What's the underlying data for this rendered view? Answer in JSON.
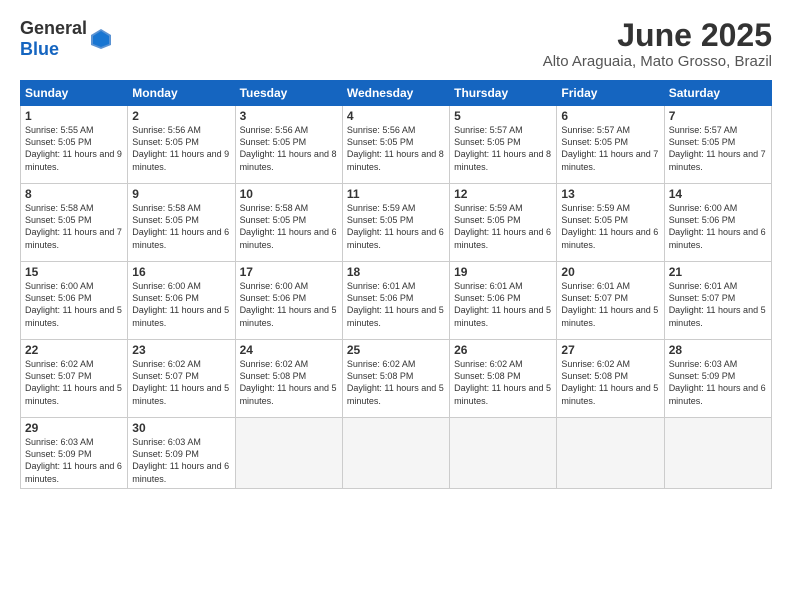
{
  "logo": {
    "general": "General",
    "blue": "Blue"
  },
  "title": "June 2025",
  "location": "Alto Araguaia, Mato Grosso, Brazil",
  "headers": [
    "Sunday",
    "Monday",
    "Tuesday",
    "Wednesday",
    "Thursday",
    "Friday",
    "Saturday"
  ],
  "weeks": [
    [
      {
        "day": "1",
        "sunrise": "5:55 AM",
        "sunset": "5:05 PM",
        "daylight": "11 hours and 9 minutes."
      },
      {
        "day": "2",
        "sunrise": "5:56 AM",
        "sunset": "5:05 PM",
        "daylight": "11 hours and 9 minutes."
      },
      {
        "day": "3",
        "sunrise": "5:56 AM",
        "sunset": "5:05 PM",
        "daylight": "11 hours and 8 minutes."
      },
      {
        "day": "4",
        "sunrise": "5:56 AM",
        "sunset": "5:05 PM",
        "daylight": "11 hours and 8 minutes."
      },
      {
        "day": "5",
        "sunrise": "5:57 AM",
        "sunset": "5:05 PM",
        "daylight": "11 hours and 8 minutes."
      },
      {
        "day": "6",
        "sunrise": "5:57 AM",
        "sunset": "5:05 PM",
        "daylight": "11 hours and 7 minutes."
      },
      {
        "day": "7",
        "sunrise": "5:57 AM",
        "sunset": "5:05 PM",
        "daylight": "11 hours and 7 minutes."
      }
    ],
    [
      {
        "day": "8",
        "sunrise": "5:58 AM",
        "sunset": "5:05 PM",
        "daylight": "11 hours and 7 minutes."
      },
      {
        "day": "9",
        "sunrise": "5:58 AM",
        "sunset": "5:05 PM",
        "daylight": "11 hours and 6 minutes."
      },
      {
        "day": "10",
        "sunrise": "5:58 AM",
        "sunset": "5:05 PM",
        "daylight": "11 hours and 6 minutes."
      },
      {
        "day": "11",
        "sunrise": "5:59 AM",
        "sunset": "5:05 PM",
        "daylight": "11 hours and 6 minutes."
      },
      {
        "day": "12",
        "sunrise": "5:59 AM",
        "sunset": "5:05 PM",
        "daylight": "11 hours and 6 minutes."
      },
      {
        "day": "13",
        "sunrise": "5:59 AM",
        "sunset": "5:05 PM",
        "daylight": "11 hours and 6 minutes."
      },
      {
        "day": "14",
        "sunrise": "6:00 AM",
        "sunset": "5:06 PM",
        "daylight": "11 hours and 6 minutes."
      }
    ],
    [
      {
        "day": "15",
        "sunrise": "6:00 AM",
        "sunset": "5:06 PM",
        "daylight": "11 hours and 5 minutes."
      },
      {
        "day": "16",
        "sunrise": "6:00 AM",
        "sunset": "5:06 PM",
        "daylight": "11 hours and 5 minutes."
      },
      {
        "day": "17",
        "sunrise": "6:00 AM",
        "sunset": "5:06 PM",
        "daylight": "11 hours and 5 minutes."
      },
      {
        "day": "18",
        "sunrise": "6:01 AM",
        "sunset": "5:06 PM",
        "daylight": "11 hours and 5 minutes."
      },
      {
        "day": "19",
        "sunrise": "6:01 AM",
        "sunset": "5:06 PM",
        "daylight": "11 hours and 5 minutes."
      },
      {
        "day": "20",
        "sunrise": "6:01 AM",
        "sunset": "5:07 PM",
        "daylight": "11 hours and 5 minutes."
      },
      {
        "day": "21",
        "sunrise": "6:01 AM",
        "sunset": "5:07 PM",
        "daylight": "11 hours and 5 minutes."
      }
    ],
    [
      {
        "day": "22",
        "sunrise": "6:02 AM",
        "sunset": "5:07 PM",
        "daylight": "11 hours and 5 minutes."
      },
      {
        "day": "23",
        "sunrise": "6:02 AM",
        "sunset": "5:07 PM",
        "daylight": "11 hours and 5 minutes."
      },
      {
        "day": "24",
        "sunrise": "6:02 AM",
        "sunset": "5:08 PM",
        "daylight": "11 hours and 5 minutes."
      },
      {
        "day": "25",
        "sunrise": "6:02 AM",
        "sunset": "5:08 PM",
        "daylight": "11 hours and 5 minutes."
      },
      {
        "day": "26",
        "sunrise": "6:02 AM",
        "sunset": "5:08 PM",
        "daylight": "11 hours and 5 minutes."
      },
      {
        "day": "27",
        "sunrise": "6:02 AM",
        "sunset": "5:08 PM",
        "daylight": "11 hours and 5 minutes."
      },
      {
        "day": "28",
        "sunrise": "6:03 AM",
        "sunset": "5:09 PM",
        "daylight": "11 hours and 6 minutes."
      }
    ],
    [
      {
        "day": "29",
        "sunrise": "6:03 AM",
        "sunset": "5:09 PM",
        "daylight": "11 hours and 6 minutes."
      },
      {
        "day": "30",
        "sunrise": "6:03 AM",
        "sunset": "5:09 PM",
        "daylight": "11 hours and 6 minutes."
      },
      null,
      null,
      null,
      null,
      null
    ]
  ]
}
